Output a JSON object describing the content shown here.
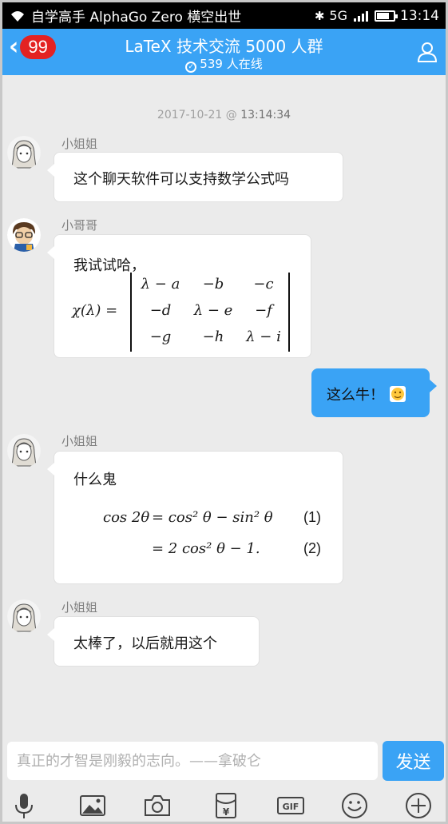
{
  "status_bar": {
    "carrier": "自学高手 AlphaGo Zero 横空出世",
    "network": "5G",
    "time": "13:14"
  },
  "header": {
    "unread_count": "99",
    "title": "LaTeX 技术交流 5000 人群",
    "online": "539 人在线"
  },
  "chat": {
    "timestamp_date": "2017-10-21 @",
    "timestamp_time": "13:14:34",
    "messages": [
      {
        "sender": "小姐姐",
        "text": "这个聊天软件可以支持数学公式吗"
      },
      {
        "sender": "小哥哥",
        "text": "我试试哈，",
        "formula_lhs": "χ(λ) =",
        "matrix": [
          [
            "λ − a",
            "−b",
            "−c"
          ],
          [
            "−d",
            "λ − e",
            "−f"
          ],
          [
            "−g",
            "−h",
            "λ − i"
          ]
        ]
      },
      {
        "sender": "me",
        "text": "这么牛！"
      },
      {
        "sender": "小姐姐",
        "text": "什么鬼",
        "equations": [
          {
            "lhs": "cos 2θ",
            "rhs": "= cos² θ − sin² θ",
            "number": "(1)"
          },
          {
            "lhs": "",
            "rhs": "= 2 cos² θ − 1.",
            "number": "(2)"
          }
        ]
      },
      {
        "sender": "小姐姐",
        "text": "太棒了，以后就用这个"
      }
    ]
  },
  "composer": {
    "placeholder": "真正的才智是刚毅的志向。——拿破仑",
    "send_label": "发送"
  },
  "toolbar_icons": [
    "microphone-icon",
    "image-icon",
    "camera-icon",
    "red-packet-icon",
    "gif-icon",
    "emoji-icon",
    "plus-icon"
  ],
  "colors": {
    "accent": "#3aa3f5",
    "badge": "#e32222",
    "background": "#ebebeb"
  }
}
